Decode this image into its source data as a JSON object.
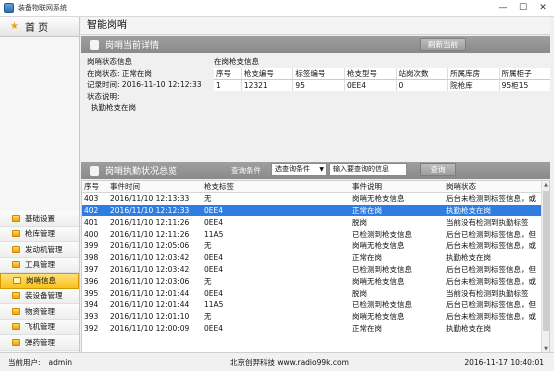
{
  "window": {
    "title": "装备物联网系统"
  },
  "sidebar": {
    "home": "首 页",
    "items": [
      {
        "label": "基础设置"
      },
      {
        "label": "枪库管理"
      },
      {
        "label": "发动机管理"
      },
      {
        "label": "工具管理"
      },
      {
        "label": "岗哨信息",
        "active": true
      },
      {
        "label": "装设备管理"
      },
      {
        "label": "物资管理"
      },
      {
        "label": "飞机管理"
      },
      {
        "label": "弹药管理"
      }
    ]
  },
  "main": {
    "title": "智能岗哨",
    "current": {
      "section_title": "岗哨当前详情",
      "refresh_label": "刷新当前",
      "status_heading": "岗哨状态信息",
      "status_label": "在岗状态:",
      "status_value": "正常在岗",
      "record_label": "记录时间:",
      "record_value": "2016-11-10 12:12:33",
      "desc_label": "状态说明:",
      "desc_value": "执勤枪支在岗",
      "gun_heading": "在岗枪支信息",
      "gun_columns": [
        "序号",
        "枪支编号",
        "标签编号",
        "枪支型号",
        "站岗次数",
        "所属库房",
        "所属柜子"
      ],
      "gun_rows": [
        [
          "1",
          "12321",
          "95",
          "0EE4",
          "0",
          "院枪库",
          "95柜15"
        ]
      ]
    },
    "history": {
      "section_title": "岗哨执勤状况总览",
      "query_label": "查询条件",
      "query_select": "选查询条件",
      "query_placeholder": "输入要查询的信息",
      "query_button": "查询",
      "columns": [
        "序号",
        "事件时间",
        "枪支标签",
        "事件说明",
        "岗哨状态"
      ],
      "rows": [
        [
          "403",
          "2016/11/10 12:13:33",
          "无",
          "岗哨无枪支信息",
          "后台未检测到标签信息，或"
        ],
        [
          "402",
          "2016/11/10 12:12:33",
          "0EE4",
          "正常在岗",
          "执勤枪支在岗"
        ],
        [
          "401",
          "2016/11/10 12:11:26",
          "0EE4",
          "脱岗",
          "当前没有检测到执勤标签"
        ],
        [
          "400",
          "2016/11/10 12:11:26",
          "11A5",
          "已检测到枪支信息",
          "后台已检测到标签信息，但"
        ],
        [
          "399",
          "2016/11/10 12:05:06",
          "无",
          "岗哨无枪支信息",
          "后台未检测到标签信息，或"
        ],
        [
          "398",
          "2016/11/10 12:03:42",
          "0EE4",
          "正常在岗",
          "执勤枪支在岗"
        ],
        [
          "397",
          "2016/11/10 12:03:42",
          "0EE4",
          "已检测到枪支信息",
          "后台已检测到标签信息，但"
        ],
        [
          "396",
          "2016/11/10 12:03:06",
          "无",
          "岗哨无枪支信息",
          "后台未检测到标签信息，或"
        ],
        [
          "395",
          "2016/11/10 12:01:44",
          "0EE4",
          "脱岗",
          "当前没有检测到执勤标签"
        ],
        [
          "394",
          "2016/11/10 12:01:44",
          "11A5",
          "已检测到枪支信息",
          "后台已检测到标签信息，但"
        ],
        [
          "393",
          "2016/11/10 12:01:10",
          "无",
          "岗哨无枪支信息",
          "后台未检测到标签信息，或"
        ],
        [
          "392",
          "2016/11/10 12:00:09",
          "0EE4",
          "正常在岗",
          "执勤枪支在岗"
        ]
      ],
      "selected_index": 1
    }
  },
  "statusbar": {
    "user_label": "当前用户:",
    "user_value": "admin",
    "company": "北京创羿科技 www.radio99k.com",
    "time": "2016-11-17 10:40:01"
  },
  "colors": {
    "selected_row": "#2f7de1",
    "section_bar": "#959595",
    "active_nav": "#f9c11a"
  }
}
